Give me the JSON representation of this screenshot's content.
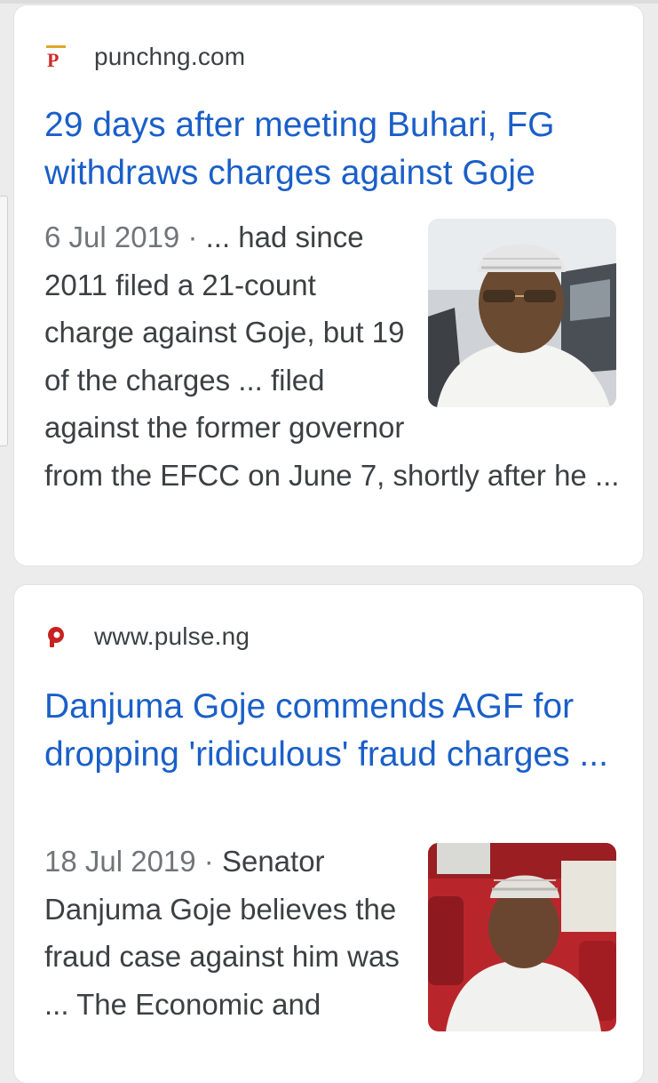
{
  "results": [
    {
      "domain": "punchng.com",
      "favicon": "punch-p-icon",
      "title": "29 days after meeting Buhari, FG withdraws charges against Goje",
      "date": "6 Jul 2019",
      "separator": " · ",
      "snippet": "... had since 2011 filed a 21-count charge against Goje, but 19 of the charges ... filed against the former governor from the EFCC on June 7, shortly after he ...",
      "thumbnail": "goje-photo"
    },
    {
      "domain": "www.pulse.ng",
      "favicon": "pulse-p-icon",
      "title": "Danjuma Goje commends AGF for dropping 'ridiculous' fraud charges ...",
      "date": "18 Jul 2019",
      "separator": " · ",
      "snippet": "Senator Danjuma Goje believes the fraud case against him was ... The Economic and",
      "thumbnail": "goje-senate-photo"
    }
  ],
  "colors": {
    "title_link": "#1a5fc8",
    "body_text": "#3c4043",
    "date_text": "#70757a",
    "punch_red": "#d12b2b",
    "pulse_red": "#c7221f"
  }
}
